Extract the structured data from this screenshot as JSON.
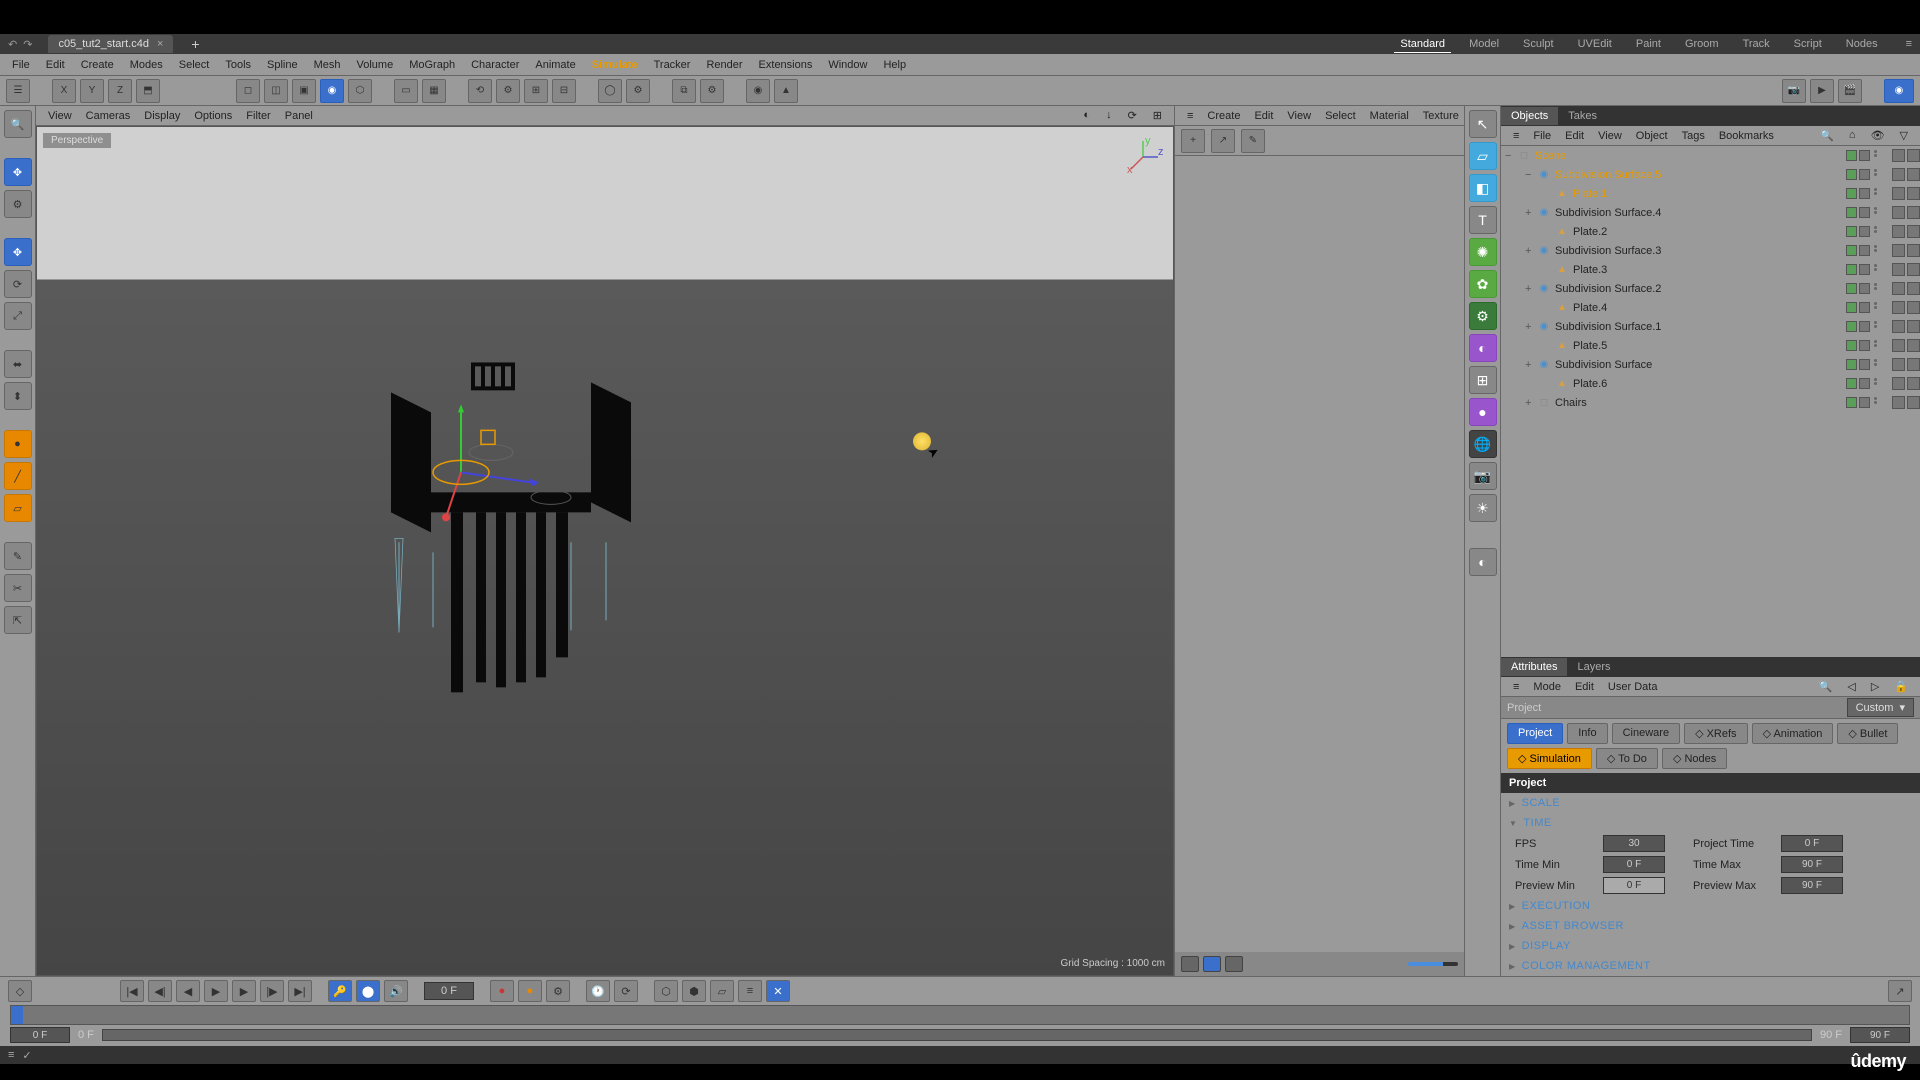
{
  "titlebar": {
    "filename": "c05_tut2_start.c4d"
  },
  "layouts": [
    "Standard",
    "Model",
    "Sculpt",
    "UVEdit",
    "Paint",
    "Groom",
    "Track",
    "Script",
    "Nodes"
  ],
  "layout_active": "Standard",
  "menubar": [
    "File",
    "Edit",
    "Create",
    "Modes",
    "Select",
    "Tools",
    "Spline",
    "Mesh",
    "Volume",
    "MoGraph",
    "Character",
    "Animate",
    "Simulate",
    "Tracker",
    "Render",
    "Extensions",
    "Window",
    "Help"
  ],
  "menu_highlight": "Simulate",
  "viewport": {
    "menu": [
      "View",
      "Cameras",
      "Display",
      "Options",
      "Filter",
      "Panel"
    ],
    "label": "Perspective",
    "grid": "Grid Spacing : 1000 cm"
  },
  "material_panel": {
    "menu": [
      "Create",
      "Edit",
      "View",
      "Select",
      "Material",
      "Texture"
    ]
  },
  "objects_panel": {
    "tabs": [
      "Objects",
      "Takes"
    ],
    "menu": [
      "File",
      "Edit",
      "View",
      "Object",
      "Tags",
      "Bookmarks"
    ],
    "items": [
      {
        "name": "Scene",
        "indent": 0,
        "sel": true,
        "icon": "null",
        "exp": "−"
      },
      {
        "name": "Subdivision Surface.5",
        "indent": 1,
        "sel": true,
        "icon": "subd",
        "exp": "−"
      },
      {
        "name": "Plate.1",
        "indent": 2,
        "sel": true,
        "icon": "mesh"
      },
      {
        "name": "Subdivision Surface.4",
        "indent": 1,
        "icon": "subd",
        "exp": "+"
      },
      {
        "name": "Plate.2",
        "indent": 2,
        "icon": "mesh"
      },
      {
        "name": "Subdivision Surface.3",
        "indent": 1,
        "icon": "subd",
        "exp": "+"
      },
      {
        "name": "Plate.3",
        "indent": 2,
        "icon": "mesh"
      },
      {
        "name": "Subdivision Surface.2",
        "indent": 1,
        "icon": "subd",
        "exp": "+"
      },
      {
        "name": "Plate.4",
        "indent": 2,
        "icon": "mesh"
      },
      {
        "name": "Subdivision Surface.1",
        "indent": 1,
        "icon": "subd",
        "exp": "+"
      },
      {
        "name": "Plate.5",
        "indent": 2,
        "icon": "mesh"
      },
      {
        "name": "Subdivision Surface",
        "indent": 1,
        "icon": "subd",
        "exp": "+"
      },
      {
        "name": "Plate.6",
        "indent": 2,
        "icon": "mesh"
      },
      {
        "name": "Chairs",
        "indent": 1,
        "icon": "null",
        "exp": "+"
      }
    ]
  },
  "attributes": {
    "tabs": [
      "Attributes",
      "Layers"
    ],
    "menu": [
      "Mode",
      "Edit",
      "User Data"
    ],
    "head": "Project",
    "mode": "Custom",
    "btns_row1": [
      {
        "l": "Project",
        "a": true
      },
      {
        "l": "Info"
      },
      {
        "l": "Cineware"
      },
      {
        "l": "◇ XRefs"
      },
      {
        "l": "◇ Animation"
      },
      {
        "l": "◇ Bullet"
      }
    ],
    "btns_row2": [
      {
        "l": "◇ Simulation",
        "o": true
      },
      {
        "l": "◇ To Do"
      },
      {
        "l": "◇ Nodes"
      }
    ],
    "section": "Project",
    "groups": {
      "scale": "SCALE",
      "time": "TIME",
      "execution": "EXECUTION",
      "asset": "ASSET BROWSER",
      "display": "DISPLAY",
      "color": "COLOR MANAGEMENT"
    },
    "time_fields": {
      "fps_l": "FPS",
      "fps_v": "30",
      "ptime_l": "Project Time",
      "ptime_v": "0 F",
      "tmin_l": "Time Min",
      "tmin_v": "0 F",
      "tmax_l": "Time Max",
      "tmax_v": "90 F",
      "pmin_l": "Preview Min",
      "pmin_v": "0 F",
      "pmax_l": "Preview Max",
      "pmax_v": "90 F"
    }
  },
  "timeline": {
    "cur_frame": "0 F",
    "start": "0 F",
    "startpos": "0 F",
    "end": "90 F",
    "endpos": "90 F"
  },
  "watermark": "ûdemy"
}
